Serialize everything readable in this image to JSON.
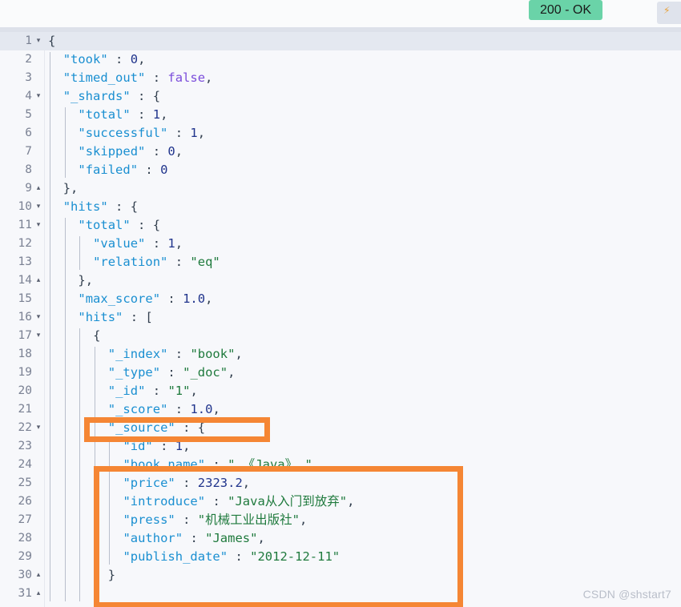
{
  "header": {
    "status_badge": "200 - OK",
    "tool_icon": "lightning-bolt-icon"
  },
  "watermark": "CSDN @shstart7",
  "colors": {
    "status_ok": "#6ad3a8",
    "annotation": "#f58634",
    "editor_background": "#f7f8fb",
    "active_line": "#e4e8f0",
    "key": "#1a8fd1",
    "string": "#1f7a3d",
    "number": "#20348c",
    "boolean": "#7b4ddb",
    "gutter_text": "#7a8193"
  },
  "editor": {
    "language": "json",
    "active_line": 1,
    "lines": [
      {
        "num": "1",
        "fold": "▾",
        "text": "{"
      },
      {
        "num": "2",
        "fold": "",
        "text": "  \"took\" : 0,"
      },
      {
        "num": "3",
        "fold": "",
        "text": "  \"timed_out\" : false,"
      },
      {
        "num": "4",
        "fold": "▾",
        "text": "  \"_shards\" : {"
      },
      {
        "num": "5",
        "fold": "",
        "text": "    \"total\" : 1,"
      },
      {
        "num": "6",
        "fold": "",
        "text": "    \"successful\" : 1,"
      },
      {
        "num": "7",
        "fold": "",
        "text": "    \"skipped\" : 0,"
      },
      {
        "num": "8",
        "fold": "",
        "text": "    \"failed\" : 0"
      },
      {
        "num": "9",
        "fold": "▴",
        "text": "  },"
      },
      {
        "num": "10",
        "fold": "▾",
        "text": "  \"hits\" : {"
      },
      {
        "num": "11",
        "fold": "▾",
        "text": "    \"total\" : {"
      },
      {
        "num": "12",
        "fold": "",
        "text": "      \"value\" : 1,"
      },
      {
        "num": "13",
        "fold": "",
        "text": "      \"relation\" : \"eq\""
      },
      {
        "num": "14",
        "fold": "▴",
        "text": "    },"
      },
      {
        "num": "15",
        "fold": "",
        "text": "    \"max_score\" : 1.0,"
      },
      {
        "num": "16",
        "fold": "▾",
        "text": "    \"hits\" : ["
      },
      {
        "num": "17",
        "fold": "▾",
        "text": "      {"
      },
      {
        "num": "18",
        "fold": "",
        "text": "        \"_index\" : \"book\","
      },
      {
        "num": "19",
        "fold": "",
        "text": "        \"_type\" : \"_doc\","
      },
      {
        "num": "20",
        "fold": "",
        "text": "        \"_id\" : \"1\","
      },
      {
        "num": "21",
        "fold": "",
        "text": "        \"_score\" : 1.0,"
      },
      {
        "num": "22",
        "fold": "▾",
        "text": "        \"_source\" : {"
      },
      {
        "num": "23",
        "fold": "",
        "text": "          \"id\" : 1,"
      },
      {
        "num": "24",
        "fold": "",
        "text": "          \"book_name\" : \" 《Java》 \","
      },
      {
        "num": "25",
        "fold": "",
        "text": "          \"price\" : 2323.2,"
      },
      {
        "num": "26",
        "fold": "",
        "text": "          \"introduce\" : \"Java从入门到放弃\","
      },
      {
        "num": "27",
        "fold": "",
        "text": "          \"press\" : \"机械工业出版社\","
      },
      {
        "num": "28",
        "fold": "",
        "text": "          \"author\" : \"James\","
      },
      {
        "num": "29",
        "fold": "",
        "text": "          \"publish_date\" : \"2012-12-11\""
      },
      {
        "num": "30",
        "fold": "▴",
        "text": "        }"
      },
      {
        "num": "31",
        "fold": "▴",
        "text": "      }"
      }
    ]
  },
  "annotations": [
    {
      "name": "id-highlight",
      "target_line": 20,
      "label": ""
    },
    {
      "name": "source-highlight",
      "target_line": 23,
      "label": ""
    }
  ]
}
